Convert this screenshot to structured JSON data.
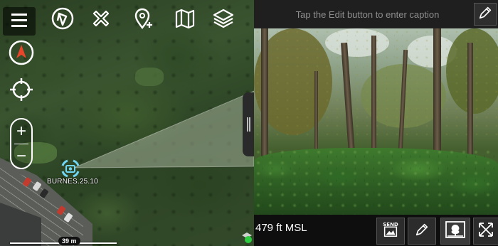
{
  "map": {
    "marker_label": "BURNES.25.10",
    "scale_label": "39 m",
    "tools": [
      "menu-icon",
      "compass-rose-icon",
      "cross-icon",
      "add-location-pin-icon",
      "folded-map-icon",
      "layers-icon"
    ]
  },
  "photo_panel": {
    "caption_placeholder": "Tap the Edit button to enter caption",
    "altitude": "479 ft MSL",
    "send_label": "SEND"
  },
  "colors": {
    "north_arrow": "#e8452b",
    "marker": "#6fd6f5",
    "gps_ok": "#2ecc40",
    "caption_text": "#8e8e8e"
  }
}
